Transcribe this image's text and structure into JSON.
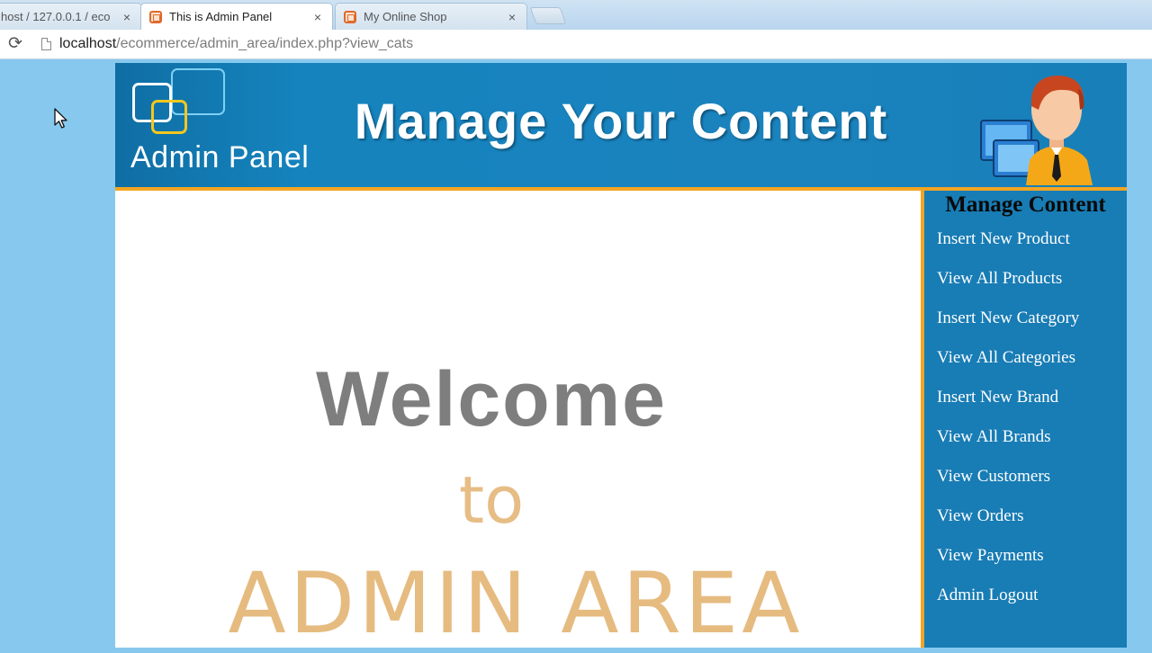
{
  "browser": {
    "tabs": [
      {
        "title": "host / 127.0.0.1 / eco",
        "active": false
      },
      {
        "title": "This is Admin Panel",
        "active": true
      },
      {
        "title": "My Online Shop",
        "active": false
      }
    ],
    "close_glyph": "×",
    "reload_glyph": "⟳",
    "url_host": "localhost",
    "url_path": "/ecommerce/admin_area/index.php?view_cats"
  },
  "header": {
    "logo_text": "Admin Panel",
    "title": "Manage Your Content"
  },
  "content": {
    "welcome": "Welcome",
    "to": "to",
    "admin_area": "ADMIN AREA"
  },
  "sidebar": {
    "title": "Manage Content",
    "items": [
      {
        "label": "Insert New Product"
      },
      {
        "label": "View All Products"
      },
      {
        "label": "Insert New Category"
      },
      {
        "label": "View All Categories"
      },
      {
        "label": "Insert New Brand"
      },
      {
        "label": "View All Brands"
      },
      {
        "label": "View Customers"
      },
      {
        "label": "View Orders"
      },
      {
        "label": "View Payments"
      },
      {
        "label": "Admin Logout"
      }
    ]
  },
  "colors": {
    "page_bg": "#87c9ee",
    "header_bg": "#1a83be",
    "accent_orange": "#f3a522",
    "sidebar_bg": "#187cb5",
    "welcome_gray": "#7e7e7e",
    "admin_tan": "#e6bb80"
  },
  "icons": {
    "tab_favicon": "xampp-icon",
    "reload": "reload-icon",
    "page": "page-icon",
    "cursor": "mouse-pointer-icon",
    "avatar": "admin-user-icon"
  }
}
